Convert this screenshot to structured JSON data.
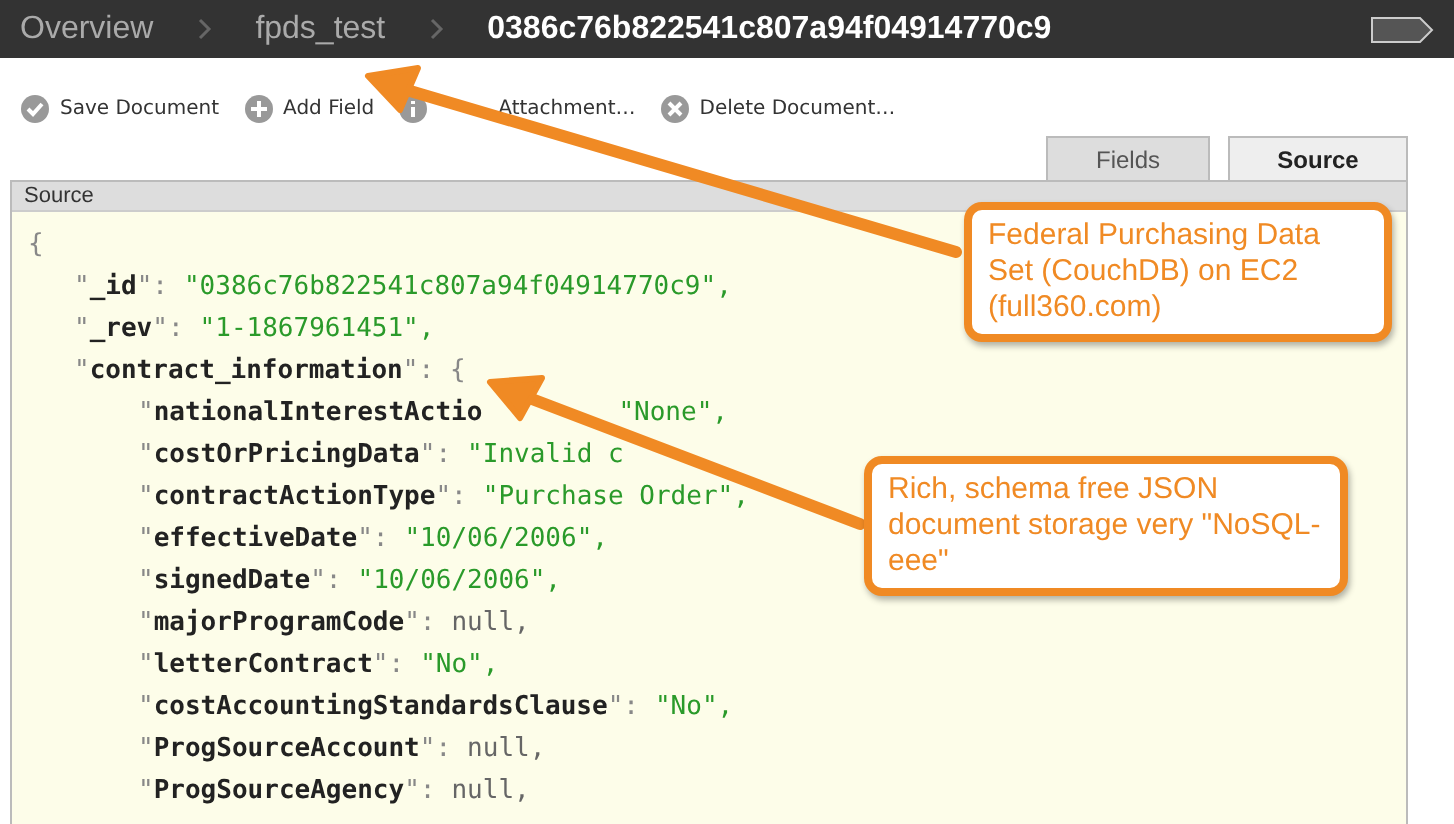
{
  "breadcrumb": [
    {
      "label": "Overview",
      "current": false
    },
    {
      "label": "fpds_test",
      "current": false
    },
    {
      "label": "0386c76b822541c807a94f04914770c9",
      "current": true
    }
  ],
  "toolbar": [
    {
      "label": "Save Document",
      "kind": "check"
    },
    {
      "label": "Add Field",
      "kind": "plus"
    },
    {
      "label": "Attachment…",
      "kind": "info"
    },
    {
      "label": "Delete Document…",
      "kind": "cross"
    }
  ],
  "tabs": [
    {
      "label": "Fields",
      "selected": false
    },
    {
      "label": "Source",
      "selected": true
    }
  ],
  "source": {
    "title": "Source",
    "open": "{",
    "fields": [
      {
        "key": "\"**_id**\":",
        "kind": "string",
        "value": "\"0386c76b822541c807a94f04914770c9\","
      },
      {
        "key": "\"**_rev**\":",
        "kind": "string",
        "value": "\"1-1867961451\","
      },
      {
        "key": "\"**contract_information**\":",
        "kind": "object",
        "value": "{",
        "children": [
          {
            "key": "\"**nationalInterestActio**",
            "kind": "obscured",
            "value": "\"None\","
          },
          {
            "key": "\"**costOrPricingData**\":",
            "kind": "string",
            "value": "\"Invalid c"
          },
          {
            "key": "\"**contractActionType**\":",
            "kind": "string",
            "value": "\"Purchase Order\","
          },
          {
            "key": "\"**effectiveDate**\":",
            "kind": "string",
            "value": "\"10/06/2006\","
          },
          {
            "key": "\"**signedDate**\":",
            "kind": "string",
            "value": "\"10/06/2006\","
          },
          {
            "key": "\"**majorProgramCode**\":",
            "kind": "literal",
            "value": "null,"
          },
          {
            "key": "\"**letterContract**\":",
            "kind": "string",
            "value": "\"No\","
          },
          {
            "key": "\"**costAccountingStandardsClause**\":",
            "kind": "string",
            "value": "\"No\","
          },
          {
            "key": "\"**ProgSourceAccount**\":",
            "kind": "literal",
            "value": "null,"
          },
          {
            "key": "\"**ProgSourceAgency**\":",
            "kind": "literal",
            "value": "null,"
          }
        ]
      }
    ]
  },
  "callouts": [
    "Federal Purchasing Data Set (CouchDB) on EC2 (full360.com)",
    "Rich, schema free JSON document storage very \"NoSQL-eee\""
  ]
}
